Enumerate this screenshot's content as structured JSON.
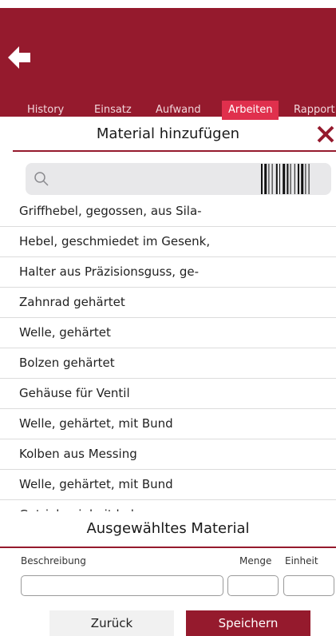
{
  "header": {
    "back_icon": "arrow-left-icon",
    "tabs": [
      {
        "label": "History",
        "active": false
      },
      {
        "label": "Einsatz",
        "active": false
      },
      {
        "label": "Aufwand",
        "active": false
      },
      {
        "label": "Arbeiten",
        "active": true
      },
      {
        "label": "Rapport",
        "active": false
      }
    ]
  },
  "dialog": {
    "title": "Material hinzufügen",
    "close_icon": "close-icon",
    "search": {
      "value": "",
      "placeholder": ""
    },
    "barcode_icon": "barcode-icon",
    "materials": [
      "Griffhebel, gegossen, aus Sila-",
      "Hebel, geschmiedet im Gesenk,",
      "Halter aus Präzisionsguss, ge-",
      "Zahnrad gehärtet",
      "Welle, gehärtet",
      "Bolzen gehärtet",
      "Gehäuse für Ventil",
      "Welle, gehärtet, mit Bund",
      "Kolben aus Messing",
      "Welle, gehärtet, mit Bund",
      "Getriebeeinheit kpl"
    ]
  },
  "selected": {
    "title": "Ausgewähltes Material",
    "labels": {
      "beschreibung": "Beschreibung",
      "menge": "Menge",
      "einheit": "Einheit"
    },
    "values": {
      "beschreibung": "",
      "menge": "",
      "einheit": ""
    }
  },
  "buttons": {
    "back": "Zurück",
    "save": "Speichern"
  },
  "colors": {
    "brand": "#951a2d",
    "active_tab": "#e0304d",
    "search_bg": "#e8e8ea"
  }
}
